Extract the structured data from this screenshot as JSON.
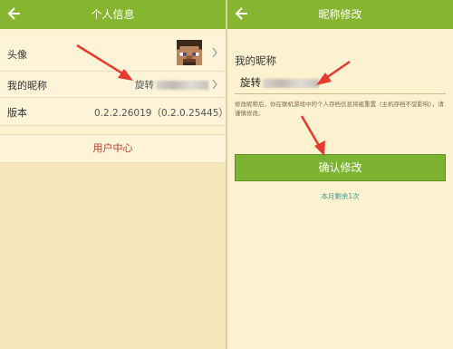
{
  "left": {
    "title": "个人信息",
    "rows": [
      {
        "label": "头像"
      },
      {
        "label": "我的昵称",
        "value": "旋转"
      },
      {
        "label": "版本",
        "value": "0.2.2.26019（0.2.0.25445）"
      }
    ],
    "user_center": "用户中心"
  },
  "right": {
    "title": "昵称修改",
    "label": "我的昵称",
    "input_value": "旋转",
    "note": "修改昵称后，你在联机游戏中的个人存档信息将被重置（主机存档不受影响），请谨慎修改。",
    "confirm_label": "确认修改",
    "remaining": "本月剩余1次"
  },
  "colors": {
    "header": "#86b52f",
    "button": "#7cb332",
    "arrow": "#e8392e",
    "link": "#c0392b"
  }
}
